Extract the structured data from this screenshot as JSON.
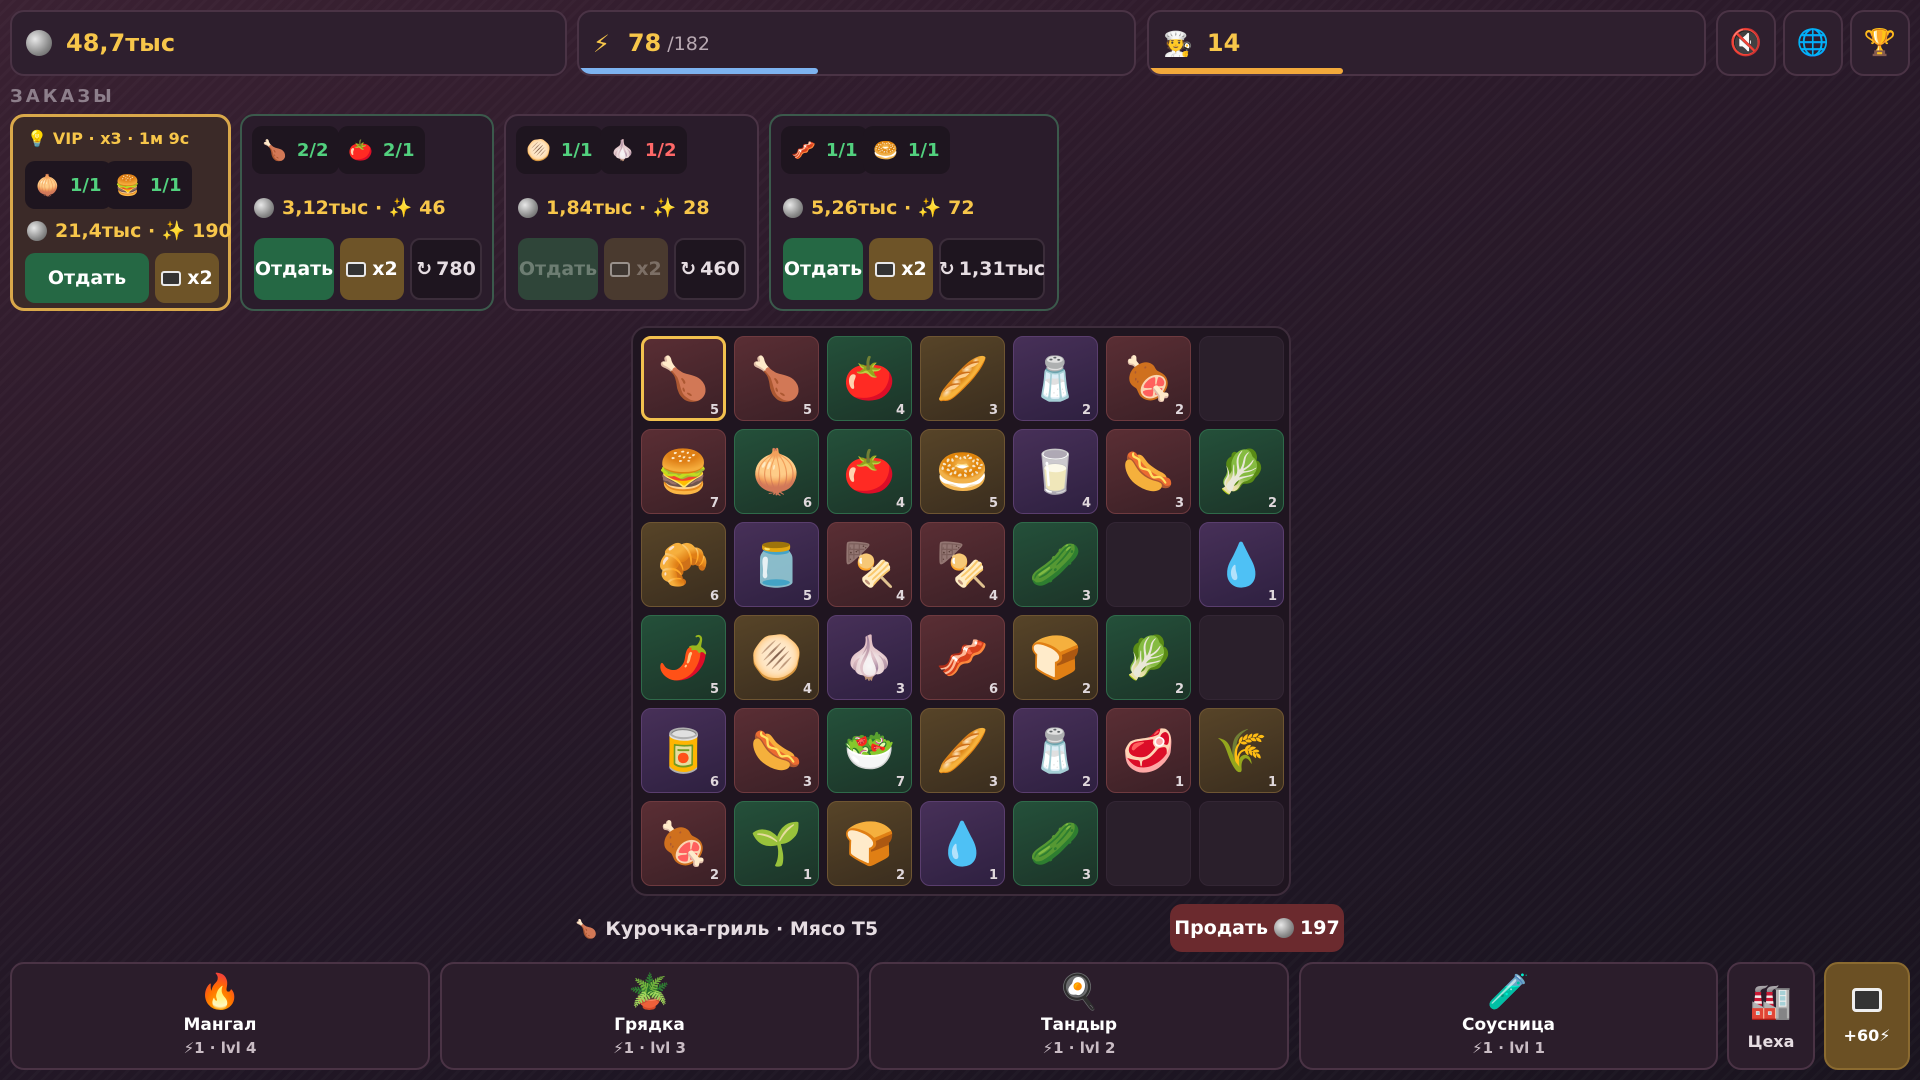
{
  "hud": {
    "coins": "48,7тыс",
    "energy": "78",
    "energy_max": "/182",
    "energy_fill": 0.43,
    "chef_level": "14",
    "chef_fill": 0.35,
    "colors": {
      "energy_bar": "#7db3f0",
      "xp_bar": "#f2a93b",
      "gold": "#f7c64a"
    }
  },
  "buttons": {
    "sound_icon": "speaker-mute-icon",
    "language_icon": "globe-icon",
    "trophy_icon": "trophy-icon"
  },
  "orders_label": "ЗАКАЗЫ",
  "orders": [
    {
      "vip_text": "VIP · x3 · 1м 9с",
      "items": [
        {
          "icon": "🧅",
          "count": "1/1",
          "ok": true
        },
        {
          "icon": "🍔",
          "count": "1/1",
          "ok": true
        }
      ],
      "coins": "21,4тыс",
      "xp": "190",
      "give_label": "Отдать",
      "tv_label": "x2"
    },
    {
      "items": [
        {
          "icon": "🍗",
          "count": "2/2",
          "ok": true
        },
        {
          "icon": "🍅",
          "count": "2/1",
          "ok": true
        }
      ],
      "coins": "3,12тыс",
      "xp": "46",
      "give_label": "Отдать",
      "tv_label": "x2",
      "refresh_label": "780"
    },
    {
      "items": [
        {
          "icon": "🫓",
          "count": "1/1",
          "ok": true
        },
        {
          "icon": "🧄",
          "count": "1/2",
          "ok": false
        }
      ],
      "coins": "1,84тыс",
      "xp": "28",
      "give_label": "Отдать",
      "tv_label": "x2",
      "refresh_label": "460"
    },
    {
      "items": [
        {
          "icon": "🥓",
          "count": "1/1",
          "ok": true
        },
        {
          "icon": "🥯",
          "count": "1/1",
          "ok": true
        }
      ],
      "coins": "5,26тыс",
      "xp": "72",
      "give_label": "Отдать",
      "tv_label": "x2",
      "refresh_label": "1,31тыс"
    }
  ],
  "board": [
    [
      {
        "e": "🍗",
        "l": "5",
        "t": "meat"
      },
      {
        "e": "🍗",
        "l": "5",
        "t": "meat"
      },
      {
        "e": "🍅",
        "l": "4",
        "t": "veg"
      },
      {
        "e": "🥖",
        "l": "3",
        "t": "bread"
      },
      {
        "e": "🧂",
        "l": "2",
        "t": "sauce"
      },
      {
        "e": "🍖",
        "l": "2",
        "t": "meat"
      },
      {
        "e": "",
        "l": "",
        "t": "empty"
      }
    ],
    [
      {
        "e": "🍔",
        "l": "7",
        "t": "meat"
      },
      {
        "e": "🧅",
        "l": "6",
        "t": "veg"
      },
      {
        "e": "🍅",
        "l": "4",
        "t": "veg"
      },
      {
        "e": "🥯",
        "l": "5",
        "t": "bread"
      },
      {
        "e": "🥛",
        "l": "4",
        "t": "sauce"
      },
      {
        "e": "🌭",
        "l": "3",
        "t": "meat"
      },
      {
        "e": "🥬",
        "l": "2",
        "t": "veg"
      }
    ],
    [
      {
        "e": "🥐",
        "l": "6",
        "t": "bread"
      },
      {
        "e": "🫙",
        "l": "5",
        "t": "sauce"
      },
      {
        "e": "🍢",
        "l": "4",
        "t": "meat"
      },
      {
        "e": "🍢",
        "l": "4",
        "t": "meat"
      },
      {
        "e": "🥒",
        "l": "3",
        "t": "veg"
      },
      {
        "e": "",
        "l": "",
        "t": "empty"
      },
      {
        "e": "💧",
        "l": "1",
        "t": "sauce"
      }
    ],
    [
      {
        "e": "🌶️",
        "l": "5",
        "t": "veg"
      },
      {
        "e": "🫓",
        "l": "4",
        "t": "bread"
      },
      {
        "e": "🧄",
        "l": "3",
        "t": "sauce"
      },
      {
        "e": "🥓",
        "l": "6",
        "t": "meat"
      },
      {
        "e": "🍞",
        "l": "2",
        "t": "bread"
      },
      {
        "e": "🥬",
        "l": "2",
        "t": "veg"
      },
      {
        "e": "",
        "l": "",
        "t": "empty"
      }
    ],
    [
      {
        "e": "🥫",
        "l": "6",
        "t": "sauce"
      },
      {
        "e": "🌭",
        "l": "3",
        "t": "meat"
      },
      {
        "e": "🥗",
        "l": "7",
        "t": "veg"
      },
      {
        "e": "🥖",
        "l": "3",
        "t": "bread"
      },
      {
        "e": "🧂",
        "l": "2",
        "t": "sauce"
      },
      {
        "e": "🥩",
        "l": "1",
        "t": "meat"
      },
      {
        "e": "🌾",
        "l": "1",
        "t": "bread"
      }
    ],
    [
      {
        "e": "🍖",
        "l": "2",
        "t": "meat"
      },
      {
        "e": "🌱",
        "l": "1",
        "t": "veg"
      },
      {
        "e": "🍞",
        "l": "2",
        "t": "bread"
      },
      {
        "e": "💧",
        "l": "1",
        "t": "sauce"
      },
      {
        "e": "🥒",
        "l": "3",
        "t": "veg"
      },
      {
        "e": "",
        "l": "",
        "t": "empty"
      },
      {
        "e": "",
        "l": "",
        "t": "empty"
      }
    ]
  ],
  "selection": {
    "icon": "🍗",
    "text": "Курочка-гриль · Мясо Т5",
    "sell_label": "Продать",
    "sell_price": "197"
  },
  "stations": [
    {
      "icon": "🔥",
      "name": "Мангал",
      "meta": "⚡1 · lvl 4"
    },
    {
      "icon": "🪴",
      "name": "Грядка",
      "meta": "⚡1 · lvl 3"
    },
    {
      "icon": "🍳",
      "name": "Тандыр",
      "meta": "⚡1 · lvl 2"
    },
    {
      "icon": "🧪",
      "name": "Соусница",
      "meta": "⚡1 · lvl 1"
    }
  ],
  "factory": {
    "icon": "🏭",
    "name": "Цеха"
  },
  "ad": {
    "name": "+60⚡"
  }
}
